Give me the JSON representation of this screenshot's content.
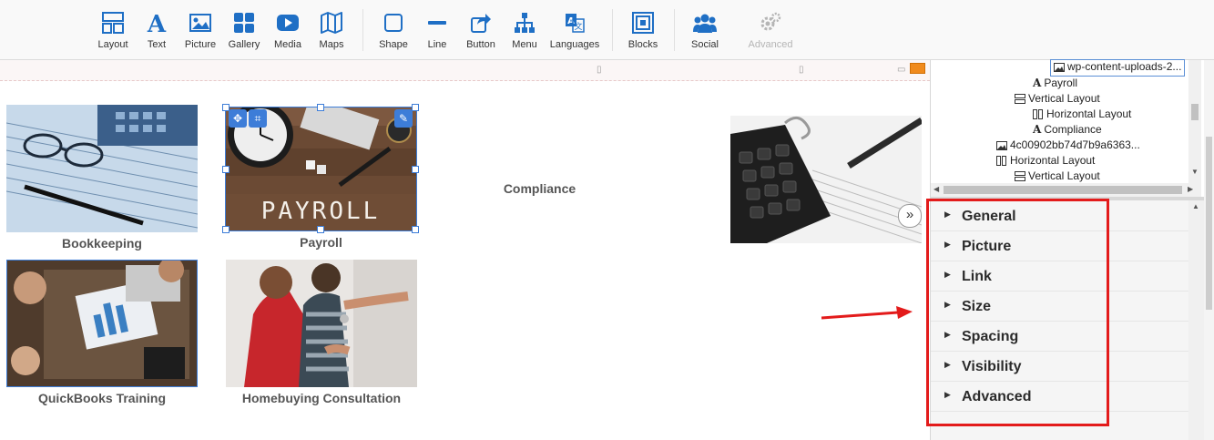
{
  "toolbar": {
    "layout": "Layout",
    "text": "Text",
    "picture": "Picture",
    "gallery": "Gallery",
    "media": "Media",
    "maps": "Maps",
    "shape": "Shape",
    "line": "Line",
    "button": "Button",
    "menu": "Menu",
    "languages": "Languages",
    "blocks": "Blocks",
    "social": "Social",
    "advanced": "Advanced"
  },
  "canvas": {
    "captions": {
      "bookkeeping": "Bookkeeping",
      "payroll": "Payroll",
      "compliance": "Compliance",
      "quickbooks": "QuickBooks Training",
      "homebuying": "Homebuying Consultation"
    },
    "payroll_image_text": "PAYROLL"
  },
  "tree": {
    "items": [
      {
        "label": "wp-content-uploads-2...",
        "icon": "image-icon"
      },
      {
        "label": "Payroll",
        "icon": "text-icon"
      },
      {
        "label": "Vertical Layout",
        "icon": "vertical-layout-icon"
      },
      {
        "label": "Horizontal Layout",
        "icon": "horizontal-layout-icon"
      },
      {
        "label": "Compliance",
        "icon": "text-icon"
      },
      {
        "label": "4c00902bb74d7b9a6363...",
        "icon": "image-icon"
      },
      {
        "label": "Horizontal Layout",
        "icon": "horizontal-layout-icon"
      },
      {
        "label": "Vertical Layout",
        "icon": "vertical-layout-icon"
      }
    ]
  },
  "properties": {
    "sections": [
      "General",
      "Picture",
      "Link",
      "Size",
      "Spacing",
      "Visibility",
      "Advanced"
    ]
  },
  "colors": {
    "accent": "#1f6fc5",
    "highlight": "#e31b1b",
    "disabled": "#b5b5b5"
  }
}
